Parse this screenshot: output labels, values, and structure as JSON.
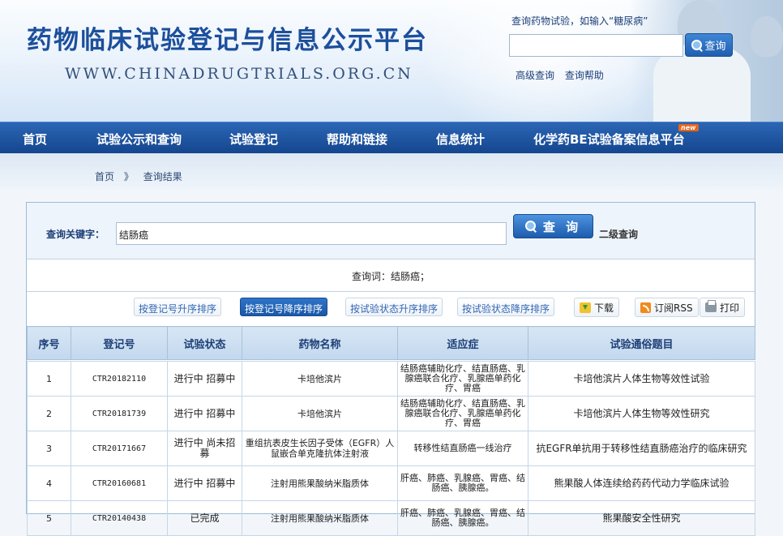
{
  "header": {
    "title": "药物临床试验登记与信息公示平台",
    "url": "WWW.CHINADRUGTRIALS.ORG.CN",
    "search_hint": "查询药物试验，如输入“糖尿病”",
    "search_button": "查询",
    "advanced_search": "高级查询",
    "search_help": "查询帮助"
  },
  "nav": {
    "items": [
      {
        "label": "首页"
      },
      {
        "label": "试验公示和查询"
      },
      {
        "label": "试验登记"
      },
      {
        "label": "帮助和链接"
      },
      {
        "label": "信息统计"
      },
      {
        "label": "化学药BE试验备案信息平台"
      }
    ],
    "new_badge": "new"
  },
  "breadcrumb": {
    "home": "首页",
    "separator": "》",
    "current": "查询结果"
  },
  "query": {
    "keyword_label": "查询关键字：",
    "keyword_value": "结肠癌",
    "search_button": "查 询",
    "level2": "二级查询",
    "query_word_text": "查询词：结肠癌；"
  },
  "sort": {
    "reg_asc": "按登记号升序排序",
    "reg_desc": "按登记号降序排序",
    "status_asc": "按试验状态升序排序",
    "status_desc": "按试验状态降序排序",
    "download": "下载",
    "rss": "订阅RSS",
    "print": "打印"
  },
  "table": {
    "headers": [
      "序号",
      "登记号",
      "试验状态",
      "药物名称",
      "适应症",
      "试验通俗题目"
    ],
    "rows": [
      {
        "no": "1",
        "reg": "CTR20182110",
        "status": "进行中 招募中",
        "drug": "卡培他滨片",
        "indication": "结肠癌辅助化疗、结直肠癌、乳腺癌联合化疗、乳腺癌单药化疗、胃癌",
        "title": "卡培他滨片人体生物等效性试验"
      },
      {
        "no": "2",
        "reg": "CTR20181739",
        "status": "进行中 招募中",
        "drug": "卡培他滨片",
        "indication": "结肠癌辅助化疗、结直肠癌、乳腺癌联合化疗、乳腺癌单药化疗、胃癌",
        "title": "卡培他滨片人体生物等效性研究"
      },
      {
        "no": "3",
        "reg": "CTR20171667",
        "status": "进行中 尚未招募",
        "drug": "重组抗表皮生长因子受体（EGFR）人鼠嵌合单克隆抗体注射液",
        "indication": "转移性结直肠癌一线治疗",
        "title": "抗EGFR单抗用于转移性结直肠癌治疗的临床研究"
      },
      {
        "no": "4",
        "reg": "CTR20160681",
        "status": "进行中 招募中",
        "drug": "注射用熊果酸纳米脂质体",
        "indication": "肝癌、肺癌、乳腺癌、胃癌、结肠癌、胰腺癌。",
        "title": "熊果酸人体连续给药药代动力学临床试验"
      },
      {
        "no": "5",
        "reg": "CTR20140438",
        "status": "已完成",
        "drug": "注射用熊果酸纳米脂质体",
        "indication": "肝癌、肺癌、乳腺癌、胃癌、结肠癌、胰腺癌。",
        "title": "熊果酸安全性研究"
      }
    ]
  },
  "colors": {
    "nav_bg": "#1f58a3",
    "title_blue": "#1c4f9c",
    "active_sort_bg": "#2264b8"
  }
}
